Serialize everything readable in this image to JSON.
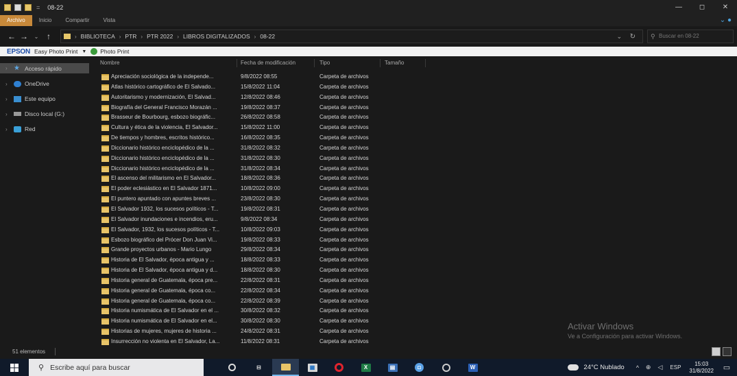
{
  "window": {
    "title": "08-22",
    "controls": {
      "minimize": "—",
      "maximize": "◻",
      "close": "✕"
    }
  },
  "ribbon": {
    "tabs": [
      "Archivo",
      "Inicio",
      "Compartir",
      "Vista"
    ],
    "help_icon": "chevron-down-help",
    "active_tab_color": "#c8893a"
  },
  "address_bar": {
    "breadcrumb": [
      "BIBLIOTECA",
      "PTR",
      "PTR 2022",
      "LIBROS DIGITALIZADOS",
      "08-22"
    ],
    "search_placeholder": "Buscar en 08-22"
  },
  "epson_bar": {
    "logo": "EPSON",
    "app_label": "Easy Photo Print",
    "photo_print_label": "Photo Print"
  },
  "nav_pane": {
    "items": [
      {
        "label": "Acceso rápido",
        "icon": "star-icon"
      },
      {
        "label": "OneDrive",
        "icon": "cloud-icon"
      },
      {
        "label": "Este equipo",
        "icon": "computer-icon"
      },
      {
        "label": "Disco local (G:)",
        "icon": "disk-icon"
      },
      {
        "label": "Red",
        "icon": "network-icon"
      }
    ]
  },
  "columns": {
    "name": "Nombre",
    "modified": "Fecha de modificación",
    "type": "Tipo",
    "size": "Tamaño"
  },
  "files": [
    {
      "name": "Apreciación sociológica de la independe...",
      "date": "9/8/2022 08:55",
      "type": "Carpeta de archivos"
    },
    {
      "name": "Atlas histórico cartográfico de El Salvado...",
      "date": "15/8/2022 11:04",
      "type": "Carpeta de archivos"
    },
    {
      "name": "Autoritarismo y modernización, El Salvad...",
      "date": "12/8/2022 08:46",
      "type": "Carpeta de archivos"
    },
    {
      "name": "Biografía del General Francisco Morazán ...",
      "date": "19/8/2022 08:37",
      "type": "Carpeta de archivos"
    },
    {
      "name": "Brasseur de Bourbourg, esbozo biográfic...",
      "date": "26/8/2022 08:58",
      "type": "Carpeta de archivos"
    },
    {
      "name": "Cultura y ética de la violencia, El Salvador...",
      "date": "15/8/2022 11:00",
      "type": "Carpeta de archivos"
    },
    {
      "name": "De tiempos y hombres, escritos histórico...",
      "date": "16/8/2022 08:35",
      "type": "Carpeta de archivos"
    },
    {
      "name": "Diccionario histórico enciclopédico de la ...",
      "date": "31/8/2022 08:32",
      "type": "Carpeta de archivos"
    },
    {
      "name": "Diccionario histórico enciclopédico de la ...",
      "date": "31/8/2022 08:30",
      "type": "Carpeta de archivos"
    },
    {
      "name": "Diccionario histórico enciclopédico de la ...",
      "date": "31/8/2022 08:34",
      "type": "Carpeta de archivos"
    },
    {
      "name": "El ascenso del militarismo en El Salvador...",
      "date": "18/8/2022 08:36",
      "type": "Carpeta de archivos"
    },
    {
      "name": "El poder eclesiástico en El Salvador 1871...",
      "date": "10/8/2022 09:00",
      "type": "Carpeta de archivos"
    },
    {
      "name": "El puntero apuntado con apuntes breves ...",
      "date": "23/8/2022 08:30",
      "type": "Carpeta de archivos"
    },
    {
      "name": "El Salvador 1932, los sucesos políticos - T...",
      "date": "19/8/2022 08:31",
      "type": "Carpeta de archivos"
    },
    {
      "name": "El Salvador inundaciones e incendios, eru...",
      "date": "9/8/2022 08:34",
      "type": "Carpeta de archivos"
    },
    {
      "name": "El Salvador, 1932, los sucesos políticos - T...",
      "date": "10/8/2022 09:03",
      "type": "Carpeta de archivos"
    },
    {
      "name": "Esbozo biográfico del Prócer Don Juan Vi...",
      "date": "19/8/2022 08:33",
      "type": "Carpeta de archivos"
    },
    {
      "name": "Grande proyectos urbanos - Mario Lungo",
      "date": "29/8/2022 08:34",
      "type": "Carpeta de archivos"
    },
    {
      "name": "Historia de El Salvador, época antigua y ...",
      "date": "18/8/2022 08:33",
      "type": "Carpeta de archivos"
    },
    {
      "name": "Historia de El Salvador, época antigua y d...",
      "date": "18/8/2022 08:30",
      "type": "Carpeta de archivos"
    },
    {
      "name": "Historia general de Guatemala, época pre...",
      "date": "22/8/2022 08:31",
      "type": "Carpeta de archivos"
    },
    {
      "name": "Historia general de Guatemala, época co...",
      "date": "22/8/2022 08:34",
      "type": "Carpeta de archivos"
    },
    {
      "name": "Historia general de Guatemala, época co...",
      "date": "22/8/2022 08:39",
      "type": "Carpeta de archivos"
    },
    {
      "name": "Historia numismática de El Salvador en el ...",
      "date": "30/8/2022 08:32",
      "type": "Carpeta de archivos"
    },
    {
      "name": "Historia numismática de El Salvador en el...",
      "date": "30/8/2022 08:30",
      "type": "Carpeta de archivos"
    },
    {
      "name": "Historias de mujeres, mujeres de historia ...",
      "date": "24/8/2022 08:31",
      "type": "Carpeta de archivos"
    },
    {
      "name": "Insurrección no violenta en El Salvador, La...",
      "date": "11/8/2022 08:31",
      "type": "Carpeta de archivos"
    }
  ],
  "watermark": {
    "title": "Activar Windows",
    "subtitle": "Ve a Configuración para activar Windows."
  },
  "status": {
    "item_count": "51 elementos"
  },
  "taskbar": {
    "search_placeholder": "Escribe aquí para buscar",
    "apps": [
      "cortana-icon",
      "task-view-icon",
      "file-explorer-icon",
      "store-icon",
      "opera-icon",
      "excel-icon",
      "calculator-icon",
      "zoom-icon",
      "camera-icon",
      "word-icon"
    ],
    "weather": "24°C  Nublado",
    "language": "ESP",
    "time": "15:03",
    "date": "31/8/2022"
  }
}
